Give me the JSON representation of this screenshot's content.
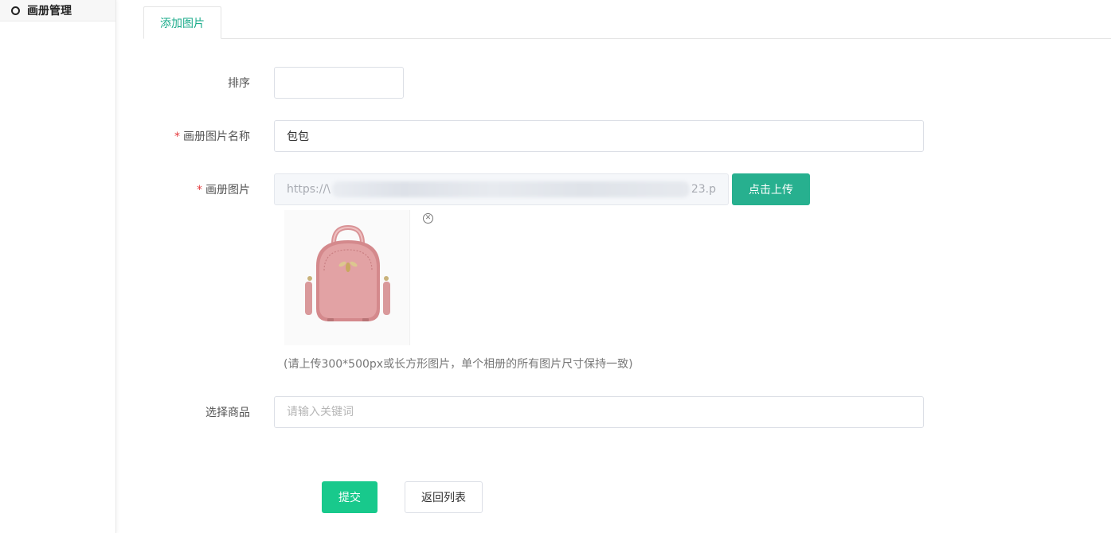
{
  "sidebar": {
    "items": [
      {
        "label": "画册管理",
        "icon": "circle-icon"
      }
    ]
  },
  "tabs": [
    {
      "label": "添加图片",
      "active": true
    }
  ],
  "form": {
    "sort": {
      "label": "排序",
      "value": ""
    },
    "name": {
      "label": "画册图片名称",
      "required": true,
      "value": "包包"
    },
    "image": {
      "label": "画册图片",
      "required": true,
      "url_prefix": "https://\\",
      "url_suffix": "23.p",
      "upload_label": "点击上传",
      "hint": "(请上传300*500px或长方形图片，单个相册的所有图片尺寸保持一致)"
    },
    "product": {
      "label": "选择商品",
      "placeholder": "请输入关键词",
      "value": ""
    },
    "submit_label": "提交",
    "back_label": "返回列表"
  },
  "colors": {
    "accent": "#1aab8a",
    "upload_button": "#27b08f",
    "submit_button": "#18c98c",
    "required_mark": "#e4393c",
    "bag": "#e2a2a4"
  }
}
